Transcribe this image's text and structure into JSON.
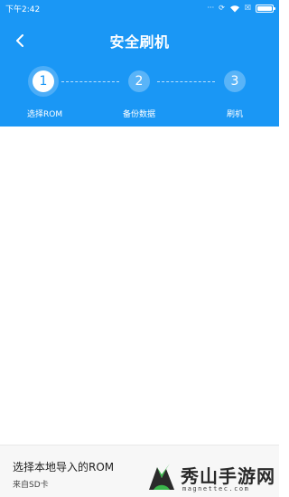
{
  "statusbar": {
    "time": "下午2:42",
    "icons": [
      "dots-icon",
      "sync-icon",
      "wifi-icon",
      "close-box-icon",
      "battery-icon"
    ],
    "dots_glyph": "···",
    "sync_glyph": "⟳",
    "close_glyph": "☒"
  },
  "header": {
    "title": "安全刷机",
    "back_icon": "back-arrow-icon",
    "background": "#1a97f5"
  },
  "steps": [
    {
      "number": "1",
      "label": "选择ROM",
      "active": true
    },
    {
      "number": "2",
      "label": "备份数据",
      "active": false
    },
    {
      "number": "3",
      "label": "刷机",
      "active": false
    }
  ],
  "bottom": {
    "title": "选择本地导入的ROM",
    "subtitle": "来自SD卡"
  },
  "watermark": {
    "text": "秀山手游网",
    "url": "magnettec.com"
  }
}
